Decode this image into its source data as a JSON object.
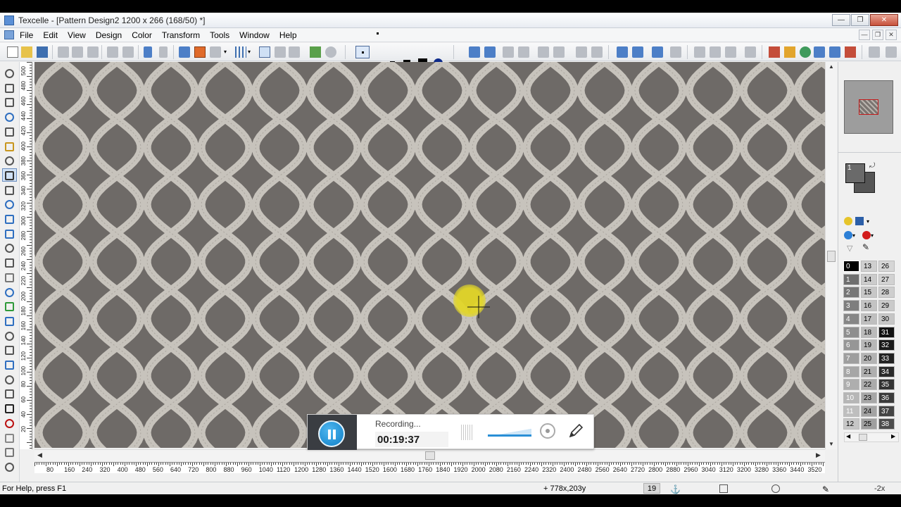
{
  "window": {
    "title": "Texcelle - [Pattern Design2 1200 x 266 (168/50) *]",
    "min_glyph": "—",
    "max_glyph": "❐",
    "close_glyph": "✕"
  },
  "menu": [
    "File",
    "Edit",
    "View",
    "Design",
    "Color",
    "Transform",
    "Tools",
    "Window",
    "Help"
  ],
  "rulers": {
    "horizontal_labels": [
      "80",
      "160",
      "240",
      "320",
      "400",
      "480",
      "560",
      "640",
      "720",
      "800",
      "880",
      "960",
      "1040",
      "1120",
      "1200",
      "1280",
      "1360",
      "1440",
      "1520",
      "1600",
      "1680",
      "1760",
      "1840",
      "1920",
      "2000",
      "2080",
      "2160",
      "2240",
      "2320",
      "2400",
      "2480",
      "2560",
      "2640",
      "2720",
      "2800",
      "2880",
      "2960",
      "3040",
      "3120",
      "3200",
      "3280",
      "3360",
      "3440",
      "3520"
    ],
    "vertical_labels": [
      "500",
      "480",
      "460",
      "440",
      "420",
      "400",
      "380",
      "360",
      "340",
      "320",
      "300",
      "280",
      "260",
      "240",
      "220",
      "200",
      "180",
      "160",
      "140",
      "120",
      "100",
      "80",
      "60",
      "40",
      "20"
    ]
  },
  "palette": {
    "cells": [
      {
        "n": "0",
        "c": "#000000",
        "t": "#ffffff"
      },
      {
        "n": "13",
        "c": "#cfcfcf",
        "t": "#000000"
      },
      {
        "n": "26",
        "c": "#d6d6d6",
        "t": "#000000"
      },
      {
        "n": "1",
        "c": "#6e6e6e",
        "t": "#ffffff"
      },
      {
        "n": "14",
        "c": "#cbcbcb",
        "t": "#000000"
      },
      {
        "n": "27",
        "c": "#d2d2d2",
        "t": "#000000"
      },
      {
        "n": "2",
        "c": "#767676",
        "t": "#ffffff"
      },
      {
        "n": "15",
        "c": "#c7c7c7",
        "t": "#000000"
      },
      {
        "n": "28",
        "c": "#cecece",
        "t": "#000000"
      },
      {
        "n": "3",
        "c": "#7e7e7e",
        "t": "#ffffff"
      },
      {
        "n": "16",
        "c": "#c3c3c3",
        "t": "#000000"
      },
      {
        "n": "29",
        "c": "#cacaca",
        "t": "#000000"
      },
      {
        "n": "4",
        "c": "#868686",
        "t": "#ffffff"
      },
      {
        "n": "17",
        "c": "#bfbfbf",
        "t": "#000000"
      },
      {
        "n": "30",
        "c": "#c6c6c6",
        "t": "#000000"
      },
      {
        "n": "5",
        "c": "#8e8e8e",
        "t": "#ffffff"
      },
      {
        "n": "18",
        "c": "#bbbbbb",
        "t": "#000000"
      },
      {
        "n": "31",
        "c": "#111111",
        "t": "#ffffff"
      },
      {
        "n": "6",
        "c": "#969696",
        "t": "#ffffff"
      },
      {
        "n": "19",
        "c": "#b7b7b7",
        "t": "#000000"
      },
      {
        "n": "32",
        "c": "#1a1a1a",
        "t": "#ffffff"
      },
      {
        "n": "7",
        "c": "#9e9e9e",
        "t": "#ffffff"
      },
      {
        "n": "20",
        "c": "#b3b3b3",
        "t": "#000000"
      },
      {
        "n": "33",
        "c": "#222222",
        "t": "#ffffff"
      },
      {
        "n": "8",
        "c": "#a6a6a6",
        "t": "#ffffff"
      },
      {
        "n": "21",
        "c": "#afafaf",
        "t": "#000000"
      },
      {
        "n": "34",
        "c": "#2a2a2a",
        "t": "#ffffff"
      },
      {
        "n": "9",
        "c": "#aeaeae",
        "t": "#ffffff"
      },
      {
        "n": "22",
        "c": "#ababab",
        "t": "#000000"
      },
      {
        "n": "35",
        "c": "#333333",
        "t": "#ffffff"
      },
      {
        "n": "10",
        "c": "#b6b6b6",
        "t": "#ffffff"
      },
      {
        "n": "23",
        "c": "#a7a7a7",
        "t": "#000000"
      },
      {
        "n": "36",
        "c": "#3b3b3b",
        "t": "#ffffff"
      },
      {
        "n": "11",
        "c": "#bebebe",
        "t": "#ffffff"
      },
      {
        "n": "24",
        "c": "#a3a3a3",
        "t": "#000000"
      },
      {
        "n": "37",
        "c": "#444444",
        "t": "#ffffff"
      },
      {
        "n": "12",
        "c": "#c6c6c6",
        "t": "#000000"
      },
      {
        "n": "25",
        "c": "#9f9f9f",
        "t": "#000000"
      },
      {
        "n": "38",
        "c": "#4c4c4c",
        "t": "#ffffff"
      }
    ]
  },
  "color_box": {
    "index_label": "1",
    "foreground": "#6a6a6a",
    "background": "#555555"
  },
  "status": {
    "help": "For Help, press F1",
    "coord": "+ 778x,203y",
    "index": "19",
    "zoom": "-2x"
  },
  "recorder": {
    "status": "Recording...",
    "time": "00:19:37"
  },
  "design": {
    "background": "#6e6a67",
    "lattice": "#c7c3bc"
  }
}
